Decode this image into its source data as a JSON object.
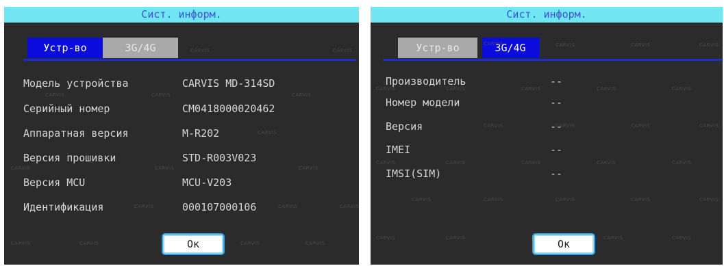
{
  "watermark_text": "CARVIS",
  "colors": {
    "panel_bg": "#2b2b2b",
    "title_bg": "#6fe6f2",
    "title_text": "#3b55d8",
    "tab_active": "#0a0dde",
    "tab_inactive": "#a9a9a9",
    "ok_border": "#2aa6e8"
  },
  "left_panel": {
    "title": "Сист. информ.",
    "tabs": [
      {
        "label": "Устр-во",
        "active": true
      },
      {
        "label": "3G/4G",
        "active": false
      }
    ],
    "rows": [
      {
        "label": "Модель устройства",
        "value": "CARVIS MD-314SD"
      },
      {
        "label": "Серийный номер",
        "value": "CM0418000020462"
      },
      {
        "label": "Аппаратная версия",
        "value": "M-R202"
      },
      {
        "label": "Версия прошивки",
        "value": "STD-R003V023"
      },
      {
        "label": "Версия MCU",
        "value": "MCU-V203"
      },
      {
        "label": "Идентификация",
        "value": "000107000106"
      }
    ],
    "ok_label": "Ок"
  },
  "right_panel": {
    "title": "Сист. информ.",
    "tabs": [
      {
        "label": "Устр-во",
        "active": false
      },
      {
        "label": "3G/4G",
        "active": true
      }
    ],
    "rows": [
      {
        "label": "Производитель",
        "value": "--"
      },
      {
        "label": "Номер модели",
        "value": "--"
      },
      {
        "label": "Версия",
        "value": "--"
      },
      {
        "label": "IMEI",
        "value": "--"
      },
      {
        "label": "IMSI(SIM)",
        "value": "--"
      }
    ],
    "ok_label": "Ок"
  }
}
